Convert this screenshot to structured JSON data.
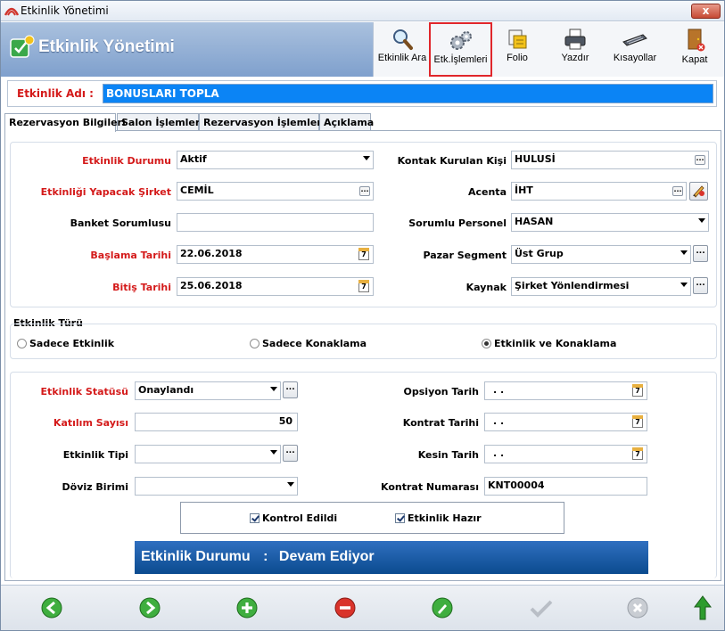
{
  "window": {
    "title": "Etkinlik Yönetimi"
  },
  "header": {
    "app_title": "Etkinlik Yönetimi"
  },
  "toolbar": {
    "items": [
      {
        "label": "Etkinlik Ara",
        "icon": "magnifier-icon"
      },
      {
        "label": "Etk.İşlemleri",
        "icon": "gears-icon"
      },
      {
        "label": "Folio",
        "icon": "folio-icon"
      },
      {
        "label": "Yazdır",
        "icon": "printer-icon"
      },
      {
        "label": "Kısayollar",
        "icon": "keyboard-icon"
      },
      {
        "label": "Kapat",
        "icon": "exit-door-icon"
      }
    ],
    "active": "Etk.İşlemleri",
    "active_border_color": "#e0262b"
  },
  "event_name": {
    "label": "Etkinlik Adı :",
    "value": "BONUSLARI TOPLA"
  },
  "tabs": [
    "Rezervasyon Bilgileri",
    "Salon İşlemleri",
    "Rezervasyon İşlemleri",
    "Açıklama"
  ],
  "form": {
    "etkinlik_durumu": {
      "label": "Etkinlik Durumu",
      "value": "Aktif"
    },
    "yapacak_sirket": {
      "label": "Etkinliği Yapacak Şirket",
      "value": "CEMİL"
    },
    "banket_sorumlusu": {
      "label": "Banket Sorumlusu",
      "value": ""
    },
    "baslama_tarihi": {
      "label": "Başlama Tarihi",
      "value": "22.06.2018"
    },
    "bitis_tarihi": {
      "label": "Bitiş Tarihi",
      "value": "25.06.2018"
    },
    "kontak_kisi": {
      "label": "Kontak Kurulan Kişi",
      "value": "HULUSİ"
    },
    "acenta": {
      "label": "Acenta",
      "value": "İHT"
    },
    "sorumlu_personel": {
      "label": "Sorumlu Personel",
      "value": "HASAN"
    },
    "pazar_segment": {
      "label": "Pazar Segment",
      "value": "Üst Grup"
    },
    "kaynak": {
      "label": "Kaynak",
      "value": "Şirket Yönlendirmesi"
    }
  },
  "etkinlik_turu": {
    "title": "Etkinlik Türü",
    "options": [
      "Sadece Etkinlik",
      "Sadece Konaklama",
      "Etkinlik ve Konaklama"
    ],
    "selected": "Etkinlik ve Konaklama"
  },
  "details": {
    "statusu": {
      "label": "Etkinlik Statüsü",
      "value": "Onaylandı"
    },
    "katilim_sayisi": {
      "label": "Katılım Sayısı",
      "value": "50"
    },
    "etkinlik_tipi": {
      "label": "Etkinlik Tipi",
      "value": ""
    },
    "doviz_birimi": {
      "label": "Döviz Birimi",
      "value": ""
    },
    "opsiyon_tarih": {
      "label": "Opsiyon Tarih",
      "value": ". ."
    },
    "kontrat_tarihi": {
      "label": "Kontrat Tarihi",
      "value": ". ."
    },
    "kesin_tarih": {
      "label": "Kesin Tarih",
      "value": ". ."
    },
    "kontrat_numarasi": {
      "label": "Kontrat Numarası",
      "value": "KNT00004"
    }
  },
  "checks": {
    "kontrol_edildi": "Kontrol Edildi",
    "etkinlik_hazir": "Etkinlik Hazır"
  },
  "status_banner": {
    "label": "Etkinlik Durumu",
    "separator": ":",
    "value": "Devam Ediyor"
  },
  "calendar_day": "7",
  "ellipsis": "...",
  "close_glyph": "x",
  "bottom_nav": [
    "back-arrow-icon",
    "forward-arrow-icon",
    "add-icon",
    "delete-icon",
    "edit-icon",
    "confirm-check-icon",
    "cancel-icon",
    "up-arrow-icon"
  ]
}
